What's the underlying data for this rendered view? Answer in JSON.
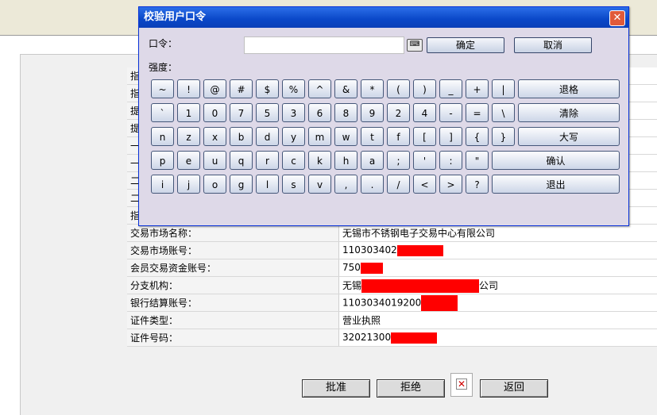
{
  "dialog": {
    "title": "校验用户口令",
    "close_glyph": "✕",
    "password_label": "口令：",
    "strength_label": "强度：",
    "password_value": "",
    "keyboard_icon_glyph": "⌨",
    "ok_label": "确定",
    "cancel_label": "取消",
    "keys_row1": [
      "~",
      "!",
      "@",
      "#",
      "$",
      "%",
      "^",
      "&",
      "*",
      "(",
      ")",
      "_",
      "+",
      "|"
    ],
    "keys_row2": [
      "`",
      "1",
      "0",
      "7",
      "5",
      "3",
      "6",
      "8",
      "9",
      "2",
      "4",
      "-",
      "=",
      "\\"
    ],
    "keys_row3": [
      "n",
      "z",
      "x",
      "b",
      "d",
      "y",
      "m",
      "w",
      "t",
      "f",
      "[",
      "]",
      "{",
      "}"
    ],
    "keys_row4": [
      "p",
      "e",
      "u",
      "q",
      "r",
      "c",
      "k",
      "h",
      "a",
      ";",
      "'",
      ":",
      "\""
    ],
    "keys_row5": [
      "i",
      "j",
      "o",
      "g",
      "l",
      "s",
      "v",
      ",",
      ".",
      "/",
      "<",
      ">",
      "?"
    ],
    "backspace_label": "退格",
    "clear_label": "清除",
    "caps_label": "大写",
    "confirm_label": "确认",
    "exit_label": "退出"
  },
  "table": {
    "hidden_labels": [
      "指",
      "指",
      "提",
      "提",
      "一",
      "一",
      "二",
      "二",
      "指"
    ],
    "rows": [
      {
        "label": "交易市场名称：",
        "value": "无锡市不锈钢电子交易中心有限公司"
      },
      {
        "label": "交易市场账号：",
        "value": "110303402"
      },
      {
        "label": "会员交易资金账号：",
        "value": "750"
      },
      {
        "label": "分支机构：",
        "value": "无锡",
        "value_suffix": "公司"
      },
      {
        "label": "银行结算账号：",
        "value": "1103034019200"
      },
      {
        "label": "证件类型：",
        "value": "营业执照"
      },
      {
        "label": "证件号码：",
        "value": "32021300"
      }
    ]
  },
  "actions": {
    "approve_label": "批准",
    "reject_label": "拒绝",
    "back_label": "返回",
    "broken_image_glyph": "✕"
  },
  "colors": {
    "titlebar": "#0a47c8",
    "redaction": "#ff0000",
    "dialog_body": "#ded9e8"
  }
}
